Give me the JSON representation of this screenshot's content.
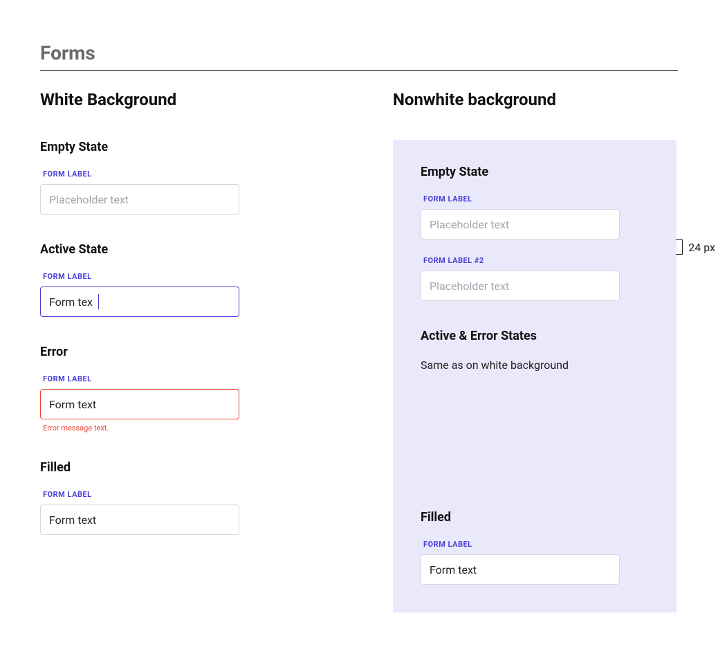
{
  "page_title": "Forms",
  "left": {
    "heading": "White Background",
    "empty": {
      "heading": "Empty State",
      "label": "FORM LABEL",
      "placeholder": "Placeholder text"
    },
    "active": {
      "heading": "Active State",
      "label": "FORM LABEL",
      "value": "Form tex"
    },
    "error": {
      "heading": "Error",
      "label": "FORM LABEL",
      "value": "Form text",
      "error_message": "Error message text."
    },
    "filled": {
      "heading": "Filled",
      "label": "FORM LABEL",
      "value": "Form text"
    }
  },
  "right": {
    "heading": "Nonwhite background",
    "empty": {
      "heading": "Empty State",
      "label1": "FORM LABEL",
      "placeholder1": "Placeholder text",
      "label2": "FORM LABEL #2",
      "placeholder2": "Placeholder text"
    },
    "spacing_note": "24 px",
    "active_error": {
      "heading": "Active & Error States",
      "note": "Same as on white background"
    },
    "filled": {
      "heading": "Filled",
      "label": "FORM LABEL",
      "value": "Form text"
    }
  }
}
